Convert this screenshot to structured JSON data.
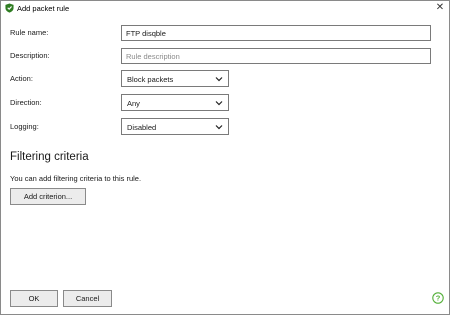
{
  "window": {
    "title": "Add packet rule"
  },
  "form": {
    "rule_name_label": "Rule name:",
    "rule_name_value": "FTP disqble",
    "description_label": "Description:",
    "description_placeholder": "Rule description",
    "action_label": "Action:",
    "action_value": "Block packets",
    "direction_label": "Direction:",
    "direction_value": "Any",
    "logging_label": "Logging:",
    "logging_value": "Disabled"
  },
  "filtering": {
    "title": "Filtering criteria",
    "description": "You can add filtering criteria to this rule.",
    "add_button": "Add criterion..."
  },
  "footer": {
    "ok_label": "OK",
    "cancel_label": "Cancel"
  },
  "icons": {
    "app": "shield-icon",
    "close": "close-icon",
    "chevron": "chevron-down-icon",
    "help": "help-icon"
  },
  "colors": {
    "brand_green": "#3a8a2a",
    "help_green": "#55b03a"
  }
}
